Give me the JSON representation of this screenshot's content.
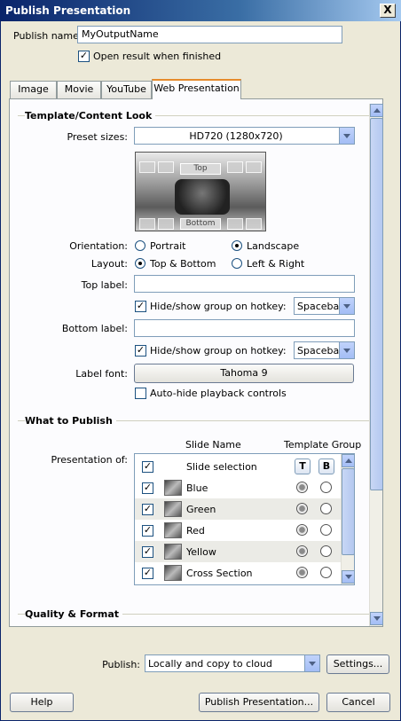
{
  "window": {
    "title": "Publish Presentation",
    "close_glyph": "X"
  },
  "publish_name": {
    "label": "Publish name:",
    "value": "MyOutputName"
  },
  "open_result": {
    "label": "Open result when finished",
    "checked": true
  },
  "tabs": [
    {
      "label": "Image",
      "active": false
    },
    {
      "label": "Movie",
      "active": false
    },
    {
      "label": "YouTube",
      "active": false
    },
    {
      "label": "Web Presentation",
      "active": true
    }
  ],
  "template": {
    "group_title": "Template/Content Look",
    "preset_label": "Preset sizes:",
    "preset_value": "HD720 (1280x720)",
    "preview": {
      "top_text": "Top",
      "bottom_text": "Bottom"
    },
    "orientation_label": "Orientation:",
    "orientation_options": [
      "Portrait",
      "Landscape"
    ],
    "orientation_selected": "Landscape",
    "layout_label": "Layout:",
    "layout_options": [
      "Top & Bottom",
      "Left & Right"
    ],
    "layout_selected": "Top & Bottom",
    "top_label": {
      "label": "Top label:",
      "value": ""
    },
    "top_hotkey": {
      "label": "Hide/show group on hotkey:",
      "checked": true,
      "value": "Spacebar"
    },
    "bottom_label": {
      "label": "Bottom label:",
      "value": ""
    },
    "bottom_hotkey": {
      "label": "Hide/show group on hotkey:",
      "checked": true,
      "value": "Spacebar"
    },
    "font_label": "Label font:",
    "font_value": "Tahoma 9",
    "autohide": {
      "label": "Auto-hide playback controls",
      "checked": false
    }
  },
  "what_to_publish": {
    "group_title": "What to Publish",
    "presentation_label": "Presentation of:",
    "col_slide_name": "Slide Name",
    "col_template_group": "Template Group",
    "selection_row": {
      "label": "Slide selection",
      "checked": true,
      "top_btn": "T",
      "bottom_btn": "B"
    },
    "slides": [
      {
        "name": "Blue",
        "checked": true,
        "group": "top"
      },
      {
        "name": "Green",
        "checked": true,
        "group": "top"
      },
      {
        "name": "Red",
        "checked": true,
        "group": "top"
      },
      {
        "name": "Yellow",
        "checked": true,
        "group": "top"
      },
      {
        "name": "Cross Section",
        "checked": true,
        "group": "top"
      }
    ]
  },
  "quality": {
    "group_title": "Quality & Format"
  },
  "publish": {
    "label": "Publish:",
    "value": "Locally and copy to cloud",
    "settings_label": "Settings..."
  },
  "footer": {
    "help_label": "Help",
    "publish_label": "Publish Presentation...",
    "cancel_label": "Cancel"
  },
  "icons": [
    "close-icon",
    "checkbox-icon",
    "dropdown-arrow-icon",
    "scroll-up-icon",
    "scroll-down-icon",
    "slide-thumbnail-icon"
  ]
}
